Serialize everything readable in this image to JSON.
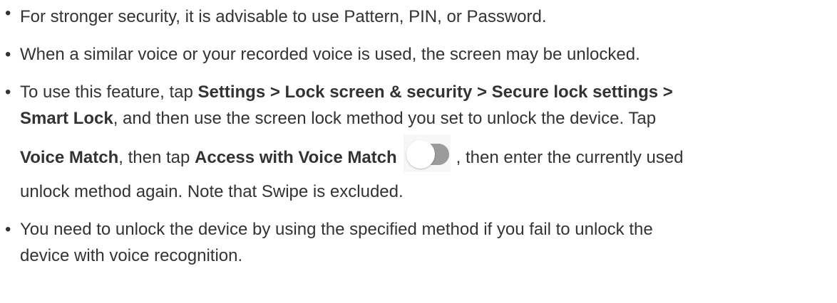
{
  "bullets": [
    {
      "text": "For stronger security, it is advisable to use Pattern, PIN, or Password."
    },
    {
      "text": "When a similar voice or your recorded voice is used, the screen may be unlocked."
    },
    {
      "intro": "To use this feature, tap ",
      "path_bold_1": "Settings > Lock screen & security > Secure lock settings >",
      "path_bold_2": "Smart Lock",
      "after_path": ", and then use the screen lock method you set to unlock the device. Tap",
      "voice_match": "Voice Match",
      "then_tap": ", then tap ",
      "access_voice_match": "Access with Voice Match",
      "after_toggle": ", then enter the currently used",
      "last_line": "unlock method again. Note that Swipe is excluded.",
      "toggle_state": "off"
    },
    {
      "line1": "You need to unlock the device by using the specified method if you fail to unlock the",
      "line2": "device with voice recognition."
    }
  ],
  "colors": {
    "text": "#333333",
    "toggle_track": "#9b9b9b",
    "toggle_knob": "#ffffff"
  },
  "icons": {
    "toggle": "toggle-switch-off-icon"
  }
}
